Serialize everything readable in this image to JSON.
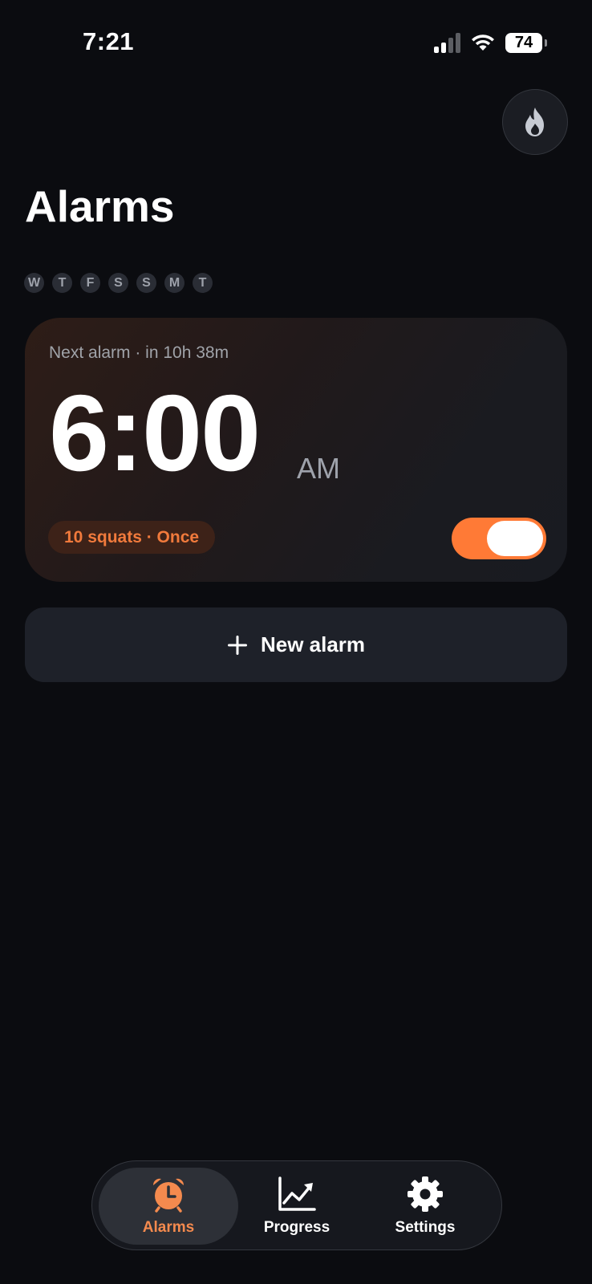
{
  "status_bar": {
    "time": "7:21",
    "battery": "74"
  },
  "header": {
    "title": "Alarms",
    "streak_icon": "flame-icon"
  },
  "weekdays": [
    "W",
    "T",
    "F",
    "S",
    "S",
    "M",
    "T"
  ],
  "alarm": {
    "next_label": "Next alarm · in 10h 38m",
    "time": "6:00",
    "ampm": "AM",
    "badge": "10 squats · Once",
    "enabled": true
  },
  "new_alarm": {
    "label": "New alarm"
  },
  "tabs": [
    {
      "label": "Alarms",
      "icon": "alarm-clock-icon",
      "active": true
    },
    {
      "label": "Progress",
      "icon": "chart-icon",
      "active": false
    },
    {
      "label": "Settings",
      "icon": "gear-icon",
      "active": false
    }
  ],
  "colors": {
    "accent": "#ff7a36",
    "background": "#0b0c10",
    "card": "#1e2129"
  }
}
